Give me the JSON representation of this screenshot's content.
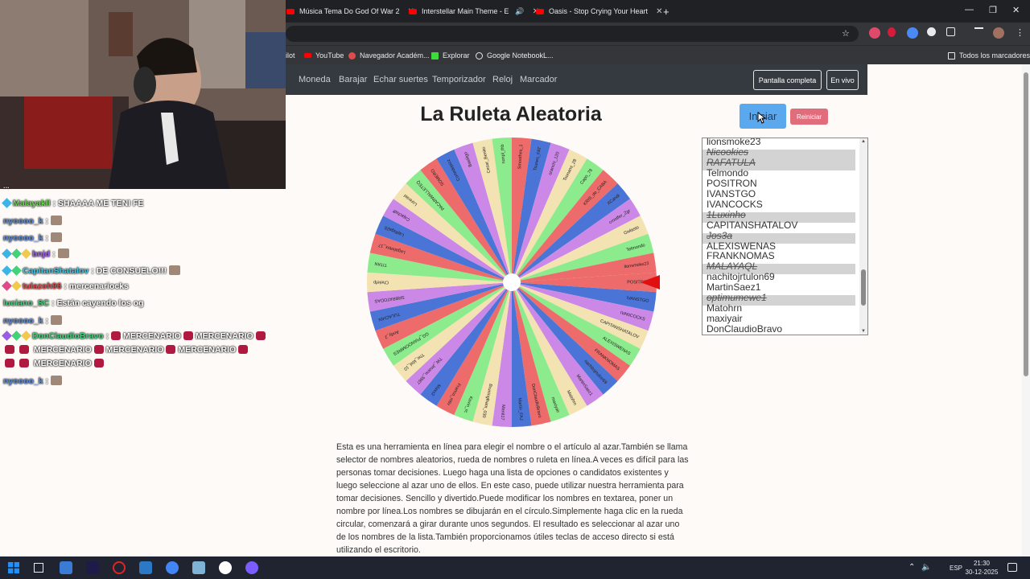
{
  "browser": {
    "tabs": [
      {
        "title": "Música Tema Do God Of War 2"
      },
      {
        "title": "Interstellar Main Theme - E"
      },
      {
        "title": "Oasis - Stop Crying Your Heart"
      }
    ],
    "new_tab_label": "+",
    "window_controls": {
      "minimize": "—",
      "restore": "❐",
      "close": "✕"
    },
    "bookmarks": [
      {
        "label": "ilot"
      },
      {
        "label": "YouTube"
      },
      {
        "label": "Navegador Académ..."
      },
      {
        "label": "Explorar"
      },
      {
        "label": "Google NotebookL..."
      }
    ],
    "all_bookmarks_label": "Todos los marcadores",
    "accent": "#ff0000"
  },
  "site": {
    "nav_links": [
      "Moneda",
      "Barajar",
      "Echar suertes",
      "Temporizador",
      "Reloj",
      "Marcador"
    ],
    "fullscreen_label": "Pantalla completa",
    "live_label": "En vivo",
    "title": "La Ruleta Aleatoria",
    "start_label": "Iniciar",
    "reset_label": "Reiniciar",
    "names": [
      {
        "text": "lionsmoke23",
        "struck": false
      },
      {
        "text": "Nicookies",
        "struck": true
      },
      {
        "text": "RAFATULA",
        "struck": true
      },
      {
        "text": "Telmondo",
        "struck": false
      },
      {
        "text": "POSITRON",
        "struck": false
      },
      {
        "text": "IVANSTGO",
        "struck": false
      },
      {
        "text": "IVANCOCKS",
        "struck": false
      },
      {
        "text": "1Luxinho",
        "struck": true
      },
      {
        "text": "CAPITANSHATALOV",
        "struck": false
      },
      {
        "text": "Jos3a",
        "struck": true
      },
      {
        "text": "ALEXISWENAS",
        "struck": false
      },
      {
        "text": "FRANKNOMAS",
        "struck": false
      },
      {
        "text": "MALAYAQL",
        "struck": true
      },
      {
        "text": "nachitojrtulon69",
        "struck": false
      },
      {
        "text": "MartinSaez1",
        "struck": false
      },
      {
        "text": "optimumewe1",
        "struck": true
      },
      {
        "text": "Matohrn",
        "struck": false
      },
      {
        "text": "maxiyair",
        "struck": false
      },
      {
        "text": "DonClaudioBravo",
        "struck": false
      }
    ],
    "description": "Esta es una herramienta en línea para elegir el nombre o el artículo al azar.También se llama selector de nombres aleatorios, rueda de nombres o ruleta en línea.A veces es difícil para las personas tomar decisiones. Luego haga una lista de opciones o candidatos existentes y luego seleccione al azar uno de ellos. En este caso, puede utilizar nuestra herramienta para tomar decisiones. Sencillo y divertido.Puede modificar los nombres en textarea, poner un nombre por línea.Los nombres se dibujarán en el círculo.Simplemente haga clic en la rueda circular, comenzará a girar durante unos segundos. El resultado es seleccionar al azar uno de los nombres de la lista.También proporcionamos útiles teclas de acceso directo si está utilizando el escritorio."
  },
  "wheel": {
    "colors": [
      "#ee6b6b",
      "#4a74d6",
      "#cc88e6",
      "#f4e3b2",
      "#8ceb8c"
    ],
    "labels": [
      "POSITRON",
      "IVANSTGO",
      "IVANCOCKS",
      "CAPITANSHATALOV",
      "ALEXISWENAS",
      "FRANKNOMAS",
      "nachitojrtulon69",
      "MartinSaez1",
      "Matohrn",
      "maxiyair",
      "DonClaudioBravo",
      "Martín_FAJ",
      "Manit17",
      "Bruninglham_030",
      "Kevin_rc",
      "Franco_mtiv",
      "Maxx2",
      "TW_Jmanu_3987",
      "The_kbd_10",
      "GG_PIANOOMIRES",
      "Andy_2",
      "TULACHIN",
      "SRBRATODAS",
      "Chelefp",
      "TITAN",
      "Legatiotox_17",
      "Laplaga25",
      "Cajachaff",
      "Loreniel",
      "PACARWALLETEQ",
      "SOMERO",
      "Cortedepizz",
      "Bastiigo",
      "Cesar_Benito",
      "nonpl_thb",
      "Smoothes_1",
      "Tsunes_FAT",
      "oranchi_120",
      "Tsunami_28",
      "Capo_78",
      "KRIS_de_CABA",
      "XCandi",
      "crootfer_Zgr",
      "Gwlasto",
      "Telmondo",
      "lionsmoke23"
    ],
    "pointer_color": "#e01010"
  },
  "chat": [
    {
      "user": "Malayakll",
      "user_color": "#66e04a",
      "text": ": SHAAAA ME TENI FE",
      "badges": [
        "#3cb4e6"
      ],
      "emotes": 0
    },
    {
      "user": "nyoooo_k",
      "user_color": "#5a8ad8",
      "text": ":",
      "badges": [],
      "emotes": 1
    },
    {
      "user": "nyoooo_k",
      "user_color": "#5a8ad8",
      "text": ":",
      "badges": [],
      "emotes": 1
    },
    {
      "user": "bnjd",
      "user_color": "#9b5de5",
      "text": ":",
      "badges": [
        "#3cb4e6",
        "#43d17a",
        "#f2c94c"
      ],
      "emotes": 1
    },
    {
      "user": "CapitanShatalov",
      "user_color": "#3cc8e6",
      "text": ": DE CONSUELO!!!",
      "badges": [
        "#3cb4e6",
        "#43d17a"
      ],
      "emotes": 1
    },
    {
      "user": "tulazoh96",
      "user_color": "#e04a4a",
      "text": ": mercenariocks",
      "badges": [
        "#e04a8a",
        "#f2c94c"
      ],
      "emotes": 0
    },
    {
      "user": "luciano_SC",
      "user_color": "#43d17a",
      "text": ": Están cayendo los og",
      "badges": [],
      "emotes": 0
    },
    {
      "user": "nyoooo_k",
      "user_color": "#5a8ad8",
      "text": ":",
      "badges": [],
      "emotes": 1
    },
    {
      "user": "DonClaudioBravo",
      "user_color": "#43d17a",
      "text": ": MERCENARIO",
      "badges": [
        "#9b5de5",
        "#43d17a",
        "#f2c94c"
      ],
      "emotes": 0
    },
    {
      "user": "",
      "user_color": "#ffffff",
      "text": "MERCENARIO",
      "badges": [],
      "emotes": 0
    },
    {
      "user": "",
      "user_color": "#ffffff",
      "text": "MERCENARIO",
      "badges": [],
      "emotes": 0
    },
    {
      "user": "nyoooo_k",
      "user_color": "#5a8ad8",
      "text": ":",
      "badges": [],
      "emotes": 1
    }
  ],
  "chat_extra": {
    "row8_more": [
      "MERCENARIO"
    ],
    "row9_more": [
      "MERCENARIO",
      "MERCENARIO"
    ],
    "top_partial": "..."
  },
  "taskbar": {
    "lang": "ESP",
    "time": "21:30",
    "date": "30-12-2025",
    "apps": [
      "#3a7bd5",
      "#1e1b4b",
      "#e02424",
      "#2b78c5",
      "#4285f4",
      "#7fb3d5",
      "#ffffff",
      "#7b5cff"
    ]
  }
}
